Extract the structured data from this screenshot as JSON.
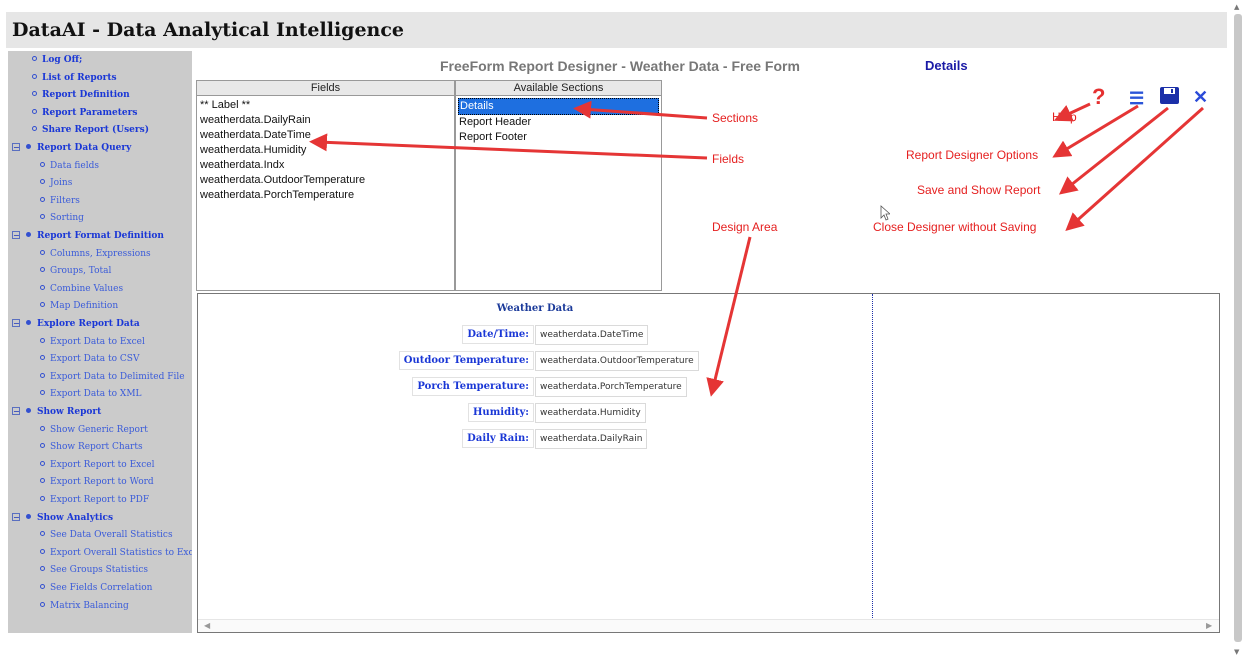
{
  "app": {
    "title": "DataAI - Data Analytical Intelligence"
  },
  "sidebar": {
    "items": [
      {
        "label": "Log Off;",
        "level": "top"
      },
      {
        "label": "List of Reports",
        "level": "top"
      },
      {
        "label": "Report Definition",
        "level": "top"
      },
      {
        "label": "Report Parameters",
        "level": "top"
      },
      {
        "label": "Share Report (Users)",
        "level": "top"
      },
      {
        "label": "Report Data Query",
        "level": "group"
      },
      {
        "label": "Data fields",
        "level": "sub"
      },
      {
        "label": "Joins",
        "level": "sub"
      },
      {
        "label": "Filters",
        "level": "sub"
      },
      {
        "label": "Sorting",
        "level": "sub"
      },
      {
        "label": "Report Format Definition",
        "level": "group"
      },
      {
        "label": "Columns, Expressions",
        "level": "sub"
      },
      {
        "label": "Groups, Total",
        "level": "sub"
      },
      {
        "label": "Combine Values",
        "level": "sub"
      },
      {
        "label": "Map Definition",
        "level": "sub"
      },
      {
        "label": "Explore Report Data",
        "level": "group"
      },
      {
        "label": "Export Data to Excel",
        "level": "sub"
      },
      {
        "label": "Export Data to CSV",
        "level": "sub"
      },
      {
        "label": "Export Data to Delimited File",
        "level": "sub"
      },
      {
        "label": "Export Data to XML",
        "level": "sub"
      },
      {
        "label": "Show Report",
        "level": "group"
      },
      {
        "label": "Show Generic Report",
        "level": "sub"
      },
      {
        "label": "Show Report Charts",
        "level": "sub"
      },
      {
        "label": "Export Report to Excel",
        "level": "sub"
      },
      {
        "label": "Export Report to Word",
        "level": "sub"
      },
      {
        "label": "Export Report to PDF",
        "level": "sub"
      },
      {
        "label": "Show Analytics",
        "level": "group"
      },
      {
        "label": "See Data Overall Statistics",
        "level": "sub"
      },
      {
        "label": "Export Overall Statistics to Exce",
        "level": "sub"
      },
      {
        "label": "See Groups Statistics",
        "level": "sub"
      },
      {
        "label": "See Fields Correlation",
        "level": "sub"
      },
      {
        "label": "Matrix Balancing",
        "level": "sub"
      }
    ]
  },
  "designer": {
    "title": "FreeForm Report Designer - Weather Data - Free Form",
    "current_section": "Details",
    "fields_header": "Fields",
    "fields": [
      "** Label **",
      "weatherdata.DailyRain",
      "weatherdata.DateTime",
      "weatherdata.Humidity",
      "weatherdata.Indx",
      "weatherdata.OutdoorTemperature",
      "weatherdata.PorchTemperature"
    ],
    "sections_header": "Available Sections",
    "sections": [
      "Details",
      "Report Header",
      "Report Footer"
    ],
    "selected_section": "Details"
  },
  "toolbar": {
    "help_icon": "question-mark-icon",
    "help_glyph": "?",
    "options_icon": "hamburger-menu-icon",
    "options_glyph": "☰",
    "save_icon": "floppy-disk-icon",
    "close_icon": "close-x-icon",
    "close_glyph": "✕",
    "colors": {
      "help": "#e53030",
      "options": "#2b55d8",
      "save": "#1b2fa8",
      "close": "#2b4bd8"
    }
  },
  "callouts": {
    "sections": "Sections",
    "fields": "Fields",
    "design_area": "Design Area",
    "help": "Help",
    "options": "Report Designer Options",
    "save": "Save and Show Report",
    "close": "Close Designer without Saving",
    "color": "#e52020"
  },
  "design": {
    "heading": "Weather Data",
    "rows": [
      {
        "label": "Date/Time:",
        "value": "weatherdata.DateTime"
      },
      {
        "label": "Outdoor Temperature:",
        "value": "weatherdata.OutdoorTemperature"
      },
      {
        "label": "Porch Temperature:",
        "value": "weatherdata.PorchTemperature"
      },
      {
        "label": "Humidity:",
        "value": "weatherdata.Humidity"
      },
      {
        "label": "Daily Rain:",
        "value": "weatherdata.DailyRain"
      }
    ]
  }
}
